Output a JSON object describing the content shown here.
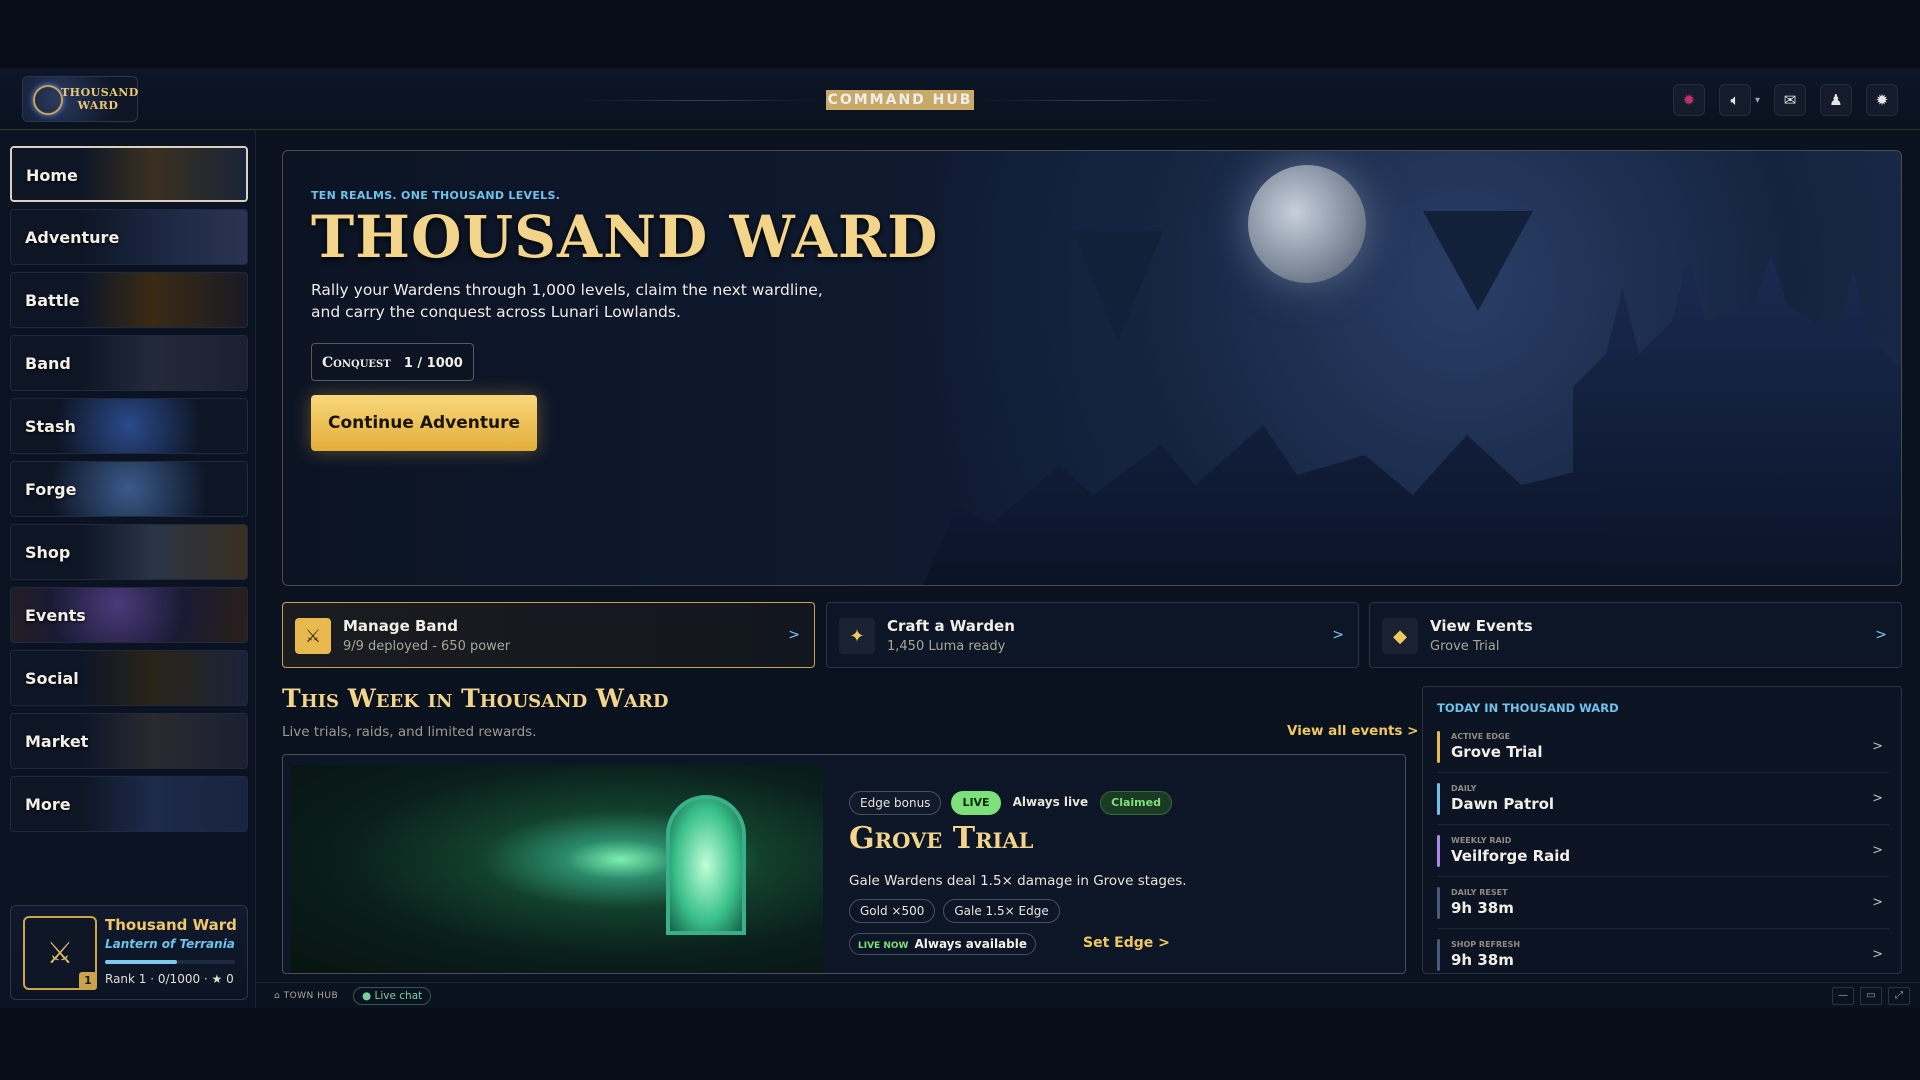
{
  "app": {
    "logo_text": "THOUSAND WARD",
    "hub_title": "COMMAND HUB"
  },
  "topbar": {
    "icons": [
      "bug-icon",
      "speaker-icon",
      "mail-icon",
      "bell-icon",
      "gear-icon"
    ]
  },
  "sidebar": {
    "items": [
      {
        "label": "Home",
        "active": true
      },
      {
        "label": "Adventure"
      },
      {
        "label": "Battle"
      },
      {
        "label": "Band"
      },
      {
        "label": "Stash"
      },
      {
        "label": "Forge"
      },
      {
        "label": "Shop"
      },
      {
        "label": "Events"
      },
      {
        "label": "Social"
      },
      {
        "label": "Market"
      },
      {
        "label": "More"
      }
    ],
    "profile": {
      "name": "Thousand Ward",
      "title": "Lantern of Terrania",
      "level": "1",
      "rank_line": "Rank 1 · 0/1000 · ★ 0",
      "progress": 0.55
    }
  },
  "hero": {
    "kicker": "TEN REALMS. ONE THOUSAND LEVELS.",
    "title": "THOUSAND WARD",
    "description": "Rally your Wardens through 1,000 levels, claim the next wardline, and carry the conquest across Lunari Lowlands.",
    "conquest_label": "Conquest",
    "conquest_value": "1 / 1000",
    "cta": "Continue Adventure"
  },
  "quick_actions": [
    {
      "title": "Manage Band",
      "subtitle": "9/9 deployed - 650 power",
      "icon": "swords-icon",
      "arrow": ">"
    },
    {
      "title": "Craft a Warden",
      "subtitle": "1,450 Luma ready",
      "icon": "sparkle-icon",
      "arrow": ">"
    },
    {
      "title": "View Events",
      "subtitle": "Grove Trial",
      "icon": "diamond-icon",
      "arrow": ">"
    }
  ],
  "week": {
    "title": "This Week in Thousand Ward",
    "subtitle": "Live trials, raids, and limited rewards.",
    "view_all": "View all events >",
    "event": {
      "tags": [
        "Edge bonus",
        "LIVE",
        "Always live",
        "Claimed"
      ],
      "title": "Grove Trial",
      "description": "Gale Wardens deal 1.5× damage in Grove stages.",
      "chips": [
        "Gold ×500",
        "Gale 1.5× Edge"
      ],
      "live_now_label": "LIVE NOW",
      "live_now_value": "Always available",
      "action": "Set Edge >"
    }
  },
  "today": {
    "heading": "TODAY IN THOUSAND WARD",
    "rows": [
      {
        "key": "ACTIVE EDGE",
        "value": "Grove Trial",
        "color": "#e8b94e"
      },
      {
        "key": "DAILY",
        "value": "Dawn Patrol",
        "color": "#6fc3ea"
      },
      {
        "key": "WEEKLY RAID",
        "value": "Veilforge Raid",
        "color": "#a98ae8"
      },
      {
        "key": "DAILY RESET",
        "value": "9h 38m",
        "color": "#4a5a78"
      },
      {
        "key": "SHOP REFRESH",
        "value": "9h 38m",
        "color": "#4a5a78"
      }
    ],
    "arrow": ">"
  },
  "statusbar": {
    "home": "⌂ TOWN HUB",
    "chat": "● Live chat",
    "window_buttons": [
      "—",
      "▭",
      "⤢"
    ]
  },
  "colors": {
    "gold": "#f2d58a",
    "accent_blue": "#6fc3ea",
    "live_green": "#7ee07a"
  }
}
